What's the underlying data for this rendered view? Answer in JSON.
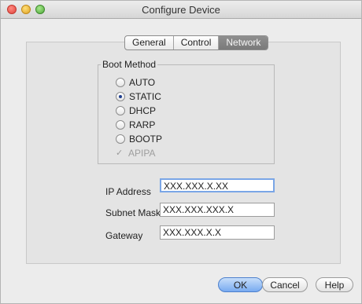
{
  "window": {
    "title": "Configure Device"
  },
  "tabs": [
    {
      "label": "General",
      "active": false
    },
    {
      "label": "Control",
      "active": false
    },
    {
      "label": "Network",
      "active": true
    }
  ],
  "boot_method": {
    "legend": "Boot Method",
    "options": [
      {
        "label": "AUTO",
        "selected": false
      },
      {
        "label": "STATIC",
        "selected": true
      },
      {
        "label": "DHCP",
        "selected": false
      },
      {
        "label": "RARP",
        "selected": false
      },
      {
        "label": "BOOTP",
        "selected": false
      }
    ],
    "apipa": {
      "label": "APIPA",
      "checked": true,
      "disabled": true
    }
  },
  "fields": {
    "ip_address": {
      "label": "IP Address",
      "value": "XXX.XXX.X.XX"
    },
    "subnet_mask": {
      "label": "Subnet Mask",
      "value": "XXX.XXX.XXX.X"
    },
    "gateway": {
      "label": "Gateway",
      "value": "XXX.XXX.X.X"
    }
  },
  "buttons": {
    "ok": "OK",
    "cancel": "Cancel",
    "help": "Help"
  },
  "colors": {
    "accent": "#78aaf0",
    "active_tab": "#848484"
  }
}
